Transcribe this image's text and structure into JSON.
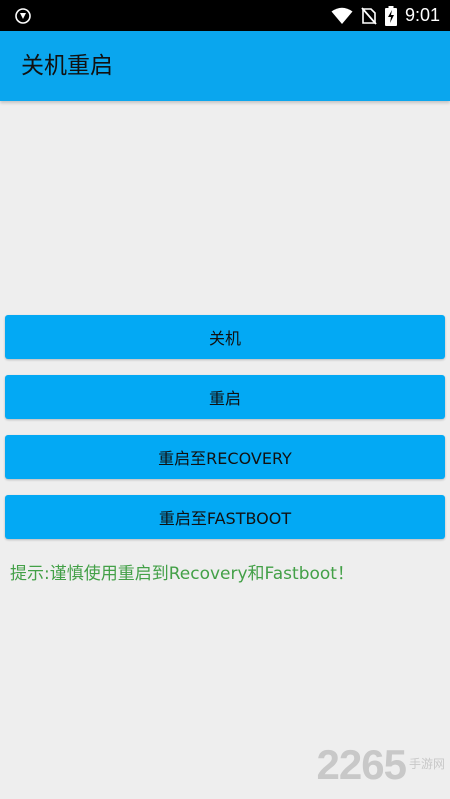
{
  "status_bar": {
    "time": "9:01",
    "icons": [
      "shield-icon",
      "wifi-icon",
      "no-sim-icon",
      "battery-charging-icon"
    ]
  },
  "app_bar": {
    "title": "关机重启",
    "color": "#0aa6ee"
  },
  "buttons": [
    {
      "label": "关机"
    },
    {
      "label": "重启"
    },
    {
      "label": "重启至RECOVERY"
    },
    {
      "label": "重启至FASTBOOT"
    }
  ],
  "button_color": "#03a9f4",
  "tip": {
    "text": "提示:谨慎使用重启到Recovery和Fastboot！",
    "color": "#43a047"
  },
  "watermark": {
    "logo": "2265",
    "text": "手游网"
  }
}
